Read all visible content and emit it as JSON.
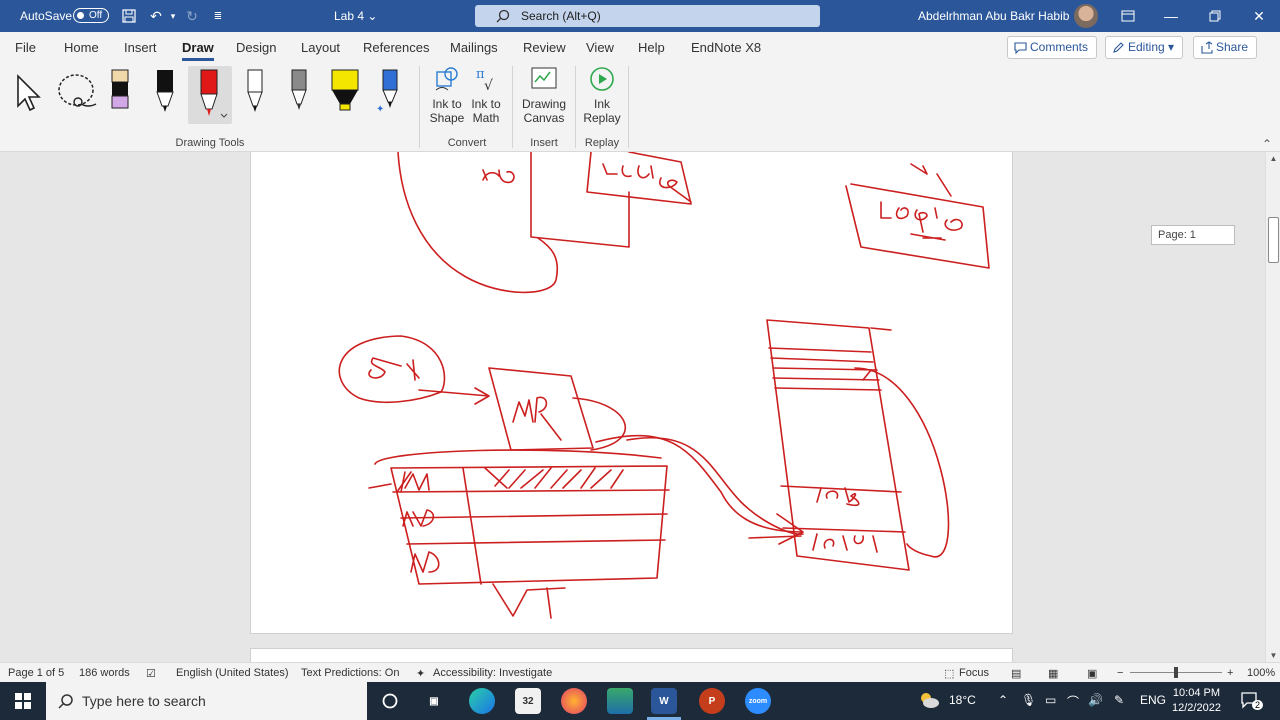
{
  "titlebar": {
    "autosave_label": "AutoSave",
    "autosave_state": "Off",
    "document_title": "Lab 4",
    "search_placeholder": "Search (Alt+Q)",
    "user_name": "Abdelrhman  Abu Bakr Habib"
  },
  "tabs": [
    "File",
    "Home",
    "Insert",
    "Draw",
    "Design",
    "Layout",
    "References",
    "Mailings",
    "Review",
    "View",
    "Help",
    "EndNote X8"
  ],
  "active_tab": "Draw",
  "header_actions": {
    "comments": "Comments",
    "editing": "Editing",
    "share": "Share"
  },
  "ribbon": {
    "drawing_tools_label": "Drawing Tools",
    "convert_label": "Convert",
    "insert_label": "Insert",
    "replay_label": "Replay",
    "ink_to_shape_l1": "Ink to",
    "ink_to_shape_l2": "Shape",
    "ink_to_math_l1": "Ink to",
    "ink_to_math_l2": "Math",
    "drawing_canvas_l1": "Drawing",
    "drawing_canvas_l2": "Canvas",
    "ink_replay_l1": "Ink",
    "ink_replay_l2": "Replay"
  },
  "canvas": {
    "page_indicator": "Page: 1"
  },
  "statusbar": {
    "page": "Page 1 of 5",
    "words": "186 words",
    "language": "English (United States)",
    "text_predictions": "Text Predictions: On",
    "accessibility": "Accessibility: Investigate",
    "focus": "Focus",
    "zoom": "100%"
  },
  "taskbar": {
    "search_placeholder": "Type here to search",
    "temperature": "18°C",
    "language": "ENG",
    "time": "10:04 PM",
    "date": "12/2/2022",
    "notification_count": "2"
  },
  "colors": {
    "title_blue": "#2b579a",
    "ink_red": "#cc1f1f",
    "taskbar": "#1d2a3a"
  }
}
